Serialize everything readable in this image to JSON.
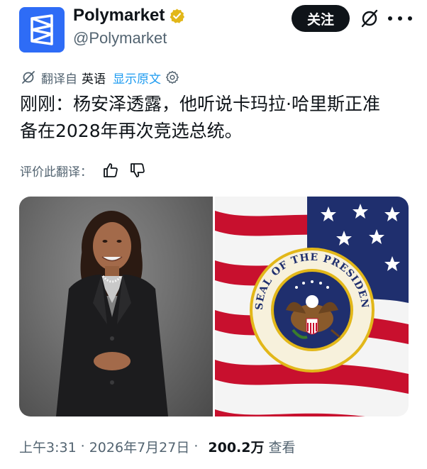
{
  "header": {
    "display_name": "Polymarket",
    "handle": "@Polymarket",
    "follow_label": "关注",
    "avatar_icon": "polymarket-logo-icon",
    "verified_icon": "verified-badge-icon",
    "brand_color": "#2e6cf6",
    "badge_color": "#e2b719"
  },
  "translation": {
    "prefix": "翻译自",
    "language": "英语",
    "show_original": "显示原文"
  },
  "tweet": {
    "text": "刚刚：杨安泽透露，他听说卡玛拉·哈里斯正准\n备在2028年再次竞选总统。"
  },
  "rate": {
    "label": "评价此翻译："
  },
  "media": {
    "seal_text": "SEAL OF THE PRESIDENT OF THE UNITED STATES"
  },
  "meta": {
    "time": "上午3:31",
    "separator": "·",
    "date": "2026年7月27日",
    "views_count": "200.2万",
    "views_label": "查看"
  }
}
